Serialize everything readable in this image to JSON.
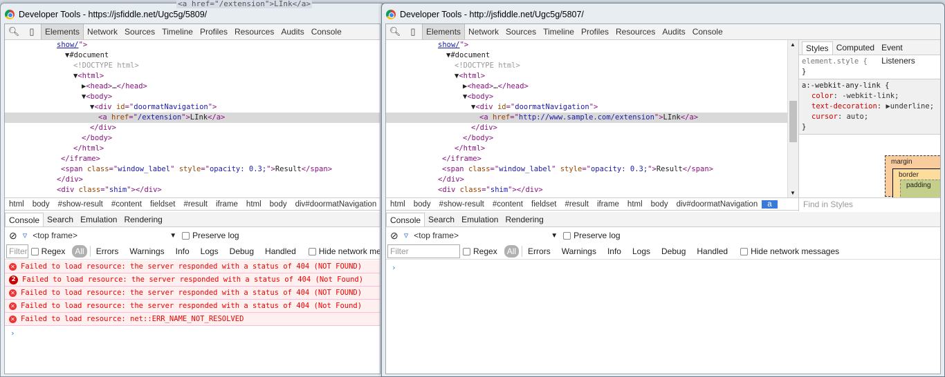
{
  "background_code": "<a href=\"/extension\">LInk</a>",
  "windows": [
    {
      "title": "Developer Tools - https://jsfiddle.net/Ugc5g/5809/",
      "toolbar": {
        "tabs": [
          "Elements",
          "Network",
          "Sources",
          "Timeline",
          "Profiles",
          "Resources",
          "Audits",
          "Console"
        ],
        "selected": "Elements"
      },
      "dom_lines": [
        {
          "indent": 0,
          "html": "<span class='lk'>show/</span><span class='tg'>\"></span>"
        },
        {
          "indent": 1,
          "html": "▼#document"
        },
        {
          "indent": 2,
          "html": "<span class='cm'>&lt;!DOCTYPE html&gt;</span>"
        },
        {
          "indent": 2,
          "html": "▼<span class='tg'>&lt;html&gt;</span>"
        },
        {
          "indent": 3,
          "html": "▶<span class='tg'>&lt;head&gt;</span>…<span class='tg'>&lt;/head&gt;</span>"
        },
        {
          "indent": 3,
          "html": "▼<span class='tg'>&lt;body&gt;</span>"
        },
        {
          "indent": 4,
          "html": "▼<span class='tg'>&lt;div </span><span class='at'>id</span><span class='tg'>=\"</span><span class='av'>doormatNavigation</span><span class='tg'>\"&gt;</span>"
        },
        {
          "indent": 5,
          "hl": true,
          "html": "<span class='tg'>&lt;a </span><span class='at'>href</span><span class='tg'>=\"</span><span class='av'>/extension</span><span class='tg'>\"&gt;</span>LInk<span class='tg'>&lt;/a&gt;</span>"
        },
        {
          "indent": 4,
          "html": "<span class='tg'>&lt;/div&gt;</span>"
        },
        {
          "indent": 3,
          "html": "<span class='tg'>&lt;/body&gt;</span>"
        },
        {
          "indent": 2,
          "html": "<span class='tg'>&lt;/html&gt;</span>"
        },
        {
          "indent": 0.5,
          "html": "<span class='tg'>&lt;/iframe&gt;</span>"
        },
        {
          "indent": 0.5,
          "html": "<span class='tg'>&lt;span </span><span class='at'>class</span><span class='tg'>=\"</span><span class='av'>window_label</span><span class='tg'>\" </span><span class='at'>style</span><span class='tg'>=\"</span><span class='av'>opacity: 0.3;</span><span class='tg'>\"&gt;</span>Result<span class='tg'>&lt;/span&gt;</span>"
        },
        {
          "indent": 0,
          "html": "<span class='tg'>&lt;/div&gt;</span>"
        },
        {
          "indent": 0,
          "html": "<span class='tg'>&lt;div </span><span class='at'>class</span><span class='tg'>=\"</span><span class='av'>shim</span><span class='tg'>\"&gt;&lt;/div&gt;</span>"
        }
      ],
      "breadcrumbs": [
        "html",
        "body",
        "#show-result",
        "#content",
        "fieldset",
        "#result",
        "iframe",
        "html",
        "body",
        "div#doormatNavigation"
      ],
      "drawer_tabs": [
        "Console",
        "Search",
        "Emulation",
        "Rendering"
      ],
      "frame": "<top frame>",
      "preserve_log": "Preserve log",
      "filter_placeholder": "Filter",
      "regex": "Regex",
      "all": "All",
      "levels": [
        "Errors",
        "Warnings",
        "Info",
        "Logs",
        "Debug",
        "Handled"
      ],
      "hide_network": "Hide network messages",
      "messages": [
        {
          "count": "",
          "text": "Failed to load resource: the server responded with a status of 404 (NOT FOUND)"
        },
        {
          "count": "2",
          "text": "Failed to load resource: the server responded with a status of 404 (Not Found)"
        },
        {
          "count": "",
          "text": "Failed to load resource: the server responded with a status of 404 (NOT FOUND)"
        },
        {
          "count": "",
          "text": "Failed to load resource: the server responded with a status of 404 (Not Found)"
        },
        {
          "count": "",
          "text": "Failed to load resource: net::ERR_NAME_NOT_RESOLVED"
        }
      ],
      "prompt": "›"
    },
    {
      "title": "Developer Tools - http://jsfiddle.net/Ugc5g/5807/",
      "link_href": "http://www.sample.com/extension",
      "breadcrumbs": [
        "html",
        "body",
        "#show-result",
        "#content",
        "fieldset",
        "#result",
        "iframe",
        "html",
        "body",
        "div#doormatNavigation",
        "a"
      ],
      "styles": {
        "tabs": [
          "Styles",
          "Computed",
          "Event Listeners"
        ],
        "element_style": "element.style {",
        "close": "}",
        "ua_selector": "a:-webkit-any-link {",
        "props": [
          {
            "name": "color",
            "value": "-webkit-link;"
          },
          {
            "name": "text-decoration",
            "value": "▶underline;"
          },
          {
            "name": "cursor",
            "value": "auto;"
          }
        ],
        "box": {
          "margin": "margin",
          "border": "border",
          "padding": "padding",
          "dash": "–"
        },
        "find_placeholder": "Find in Styles"
      }
    }
  ],
  "colors": {
    "error_text": "#e00000",
    "error_bg": "#fff0f0",
    "selected_crumb": "#3879d9"
  }
}
